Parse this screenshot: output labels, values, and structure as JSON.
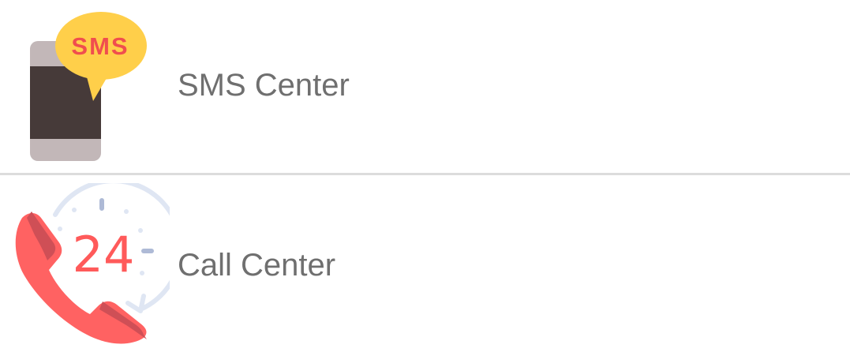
{
  "menu": {
    "items": [
      {
        "label": "SMS Center",
        "icon": "sms-phone-icon",
        "badge_text": "SMS"
      },
      {
        "label": "Call Center",
        "icon": "call-center-24-icon",
        "badge_text": "24"
      }
    ]
  },
  "colors": {
    "label_text": "#6f6f6f",
    "divider": "#dcdcdc",
    "sms_bubble": "#ffcf4a",
    "sms_text": "#f04e4e",
    "phone_body": "#c2b7b8",
    "phone_screen": "#463a39",
    "handset": "#ff6262",
    "handset_shadow": "#cf4f56",
    "clock_ring": "#dfe6f3",
    "clock_ticks": "#aebad6",
    "numeral_24": "#ff5a5a"
  }
}
